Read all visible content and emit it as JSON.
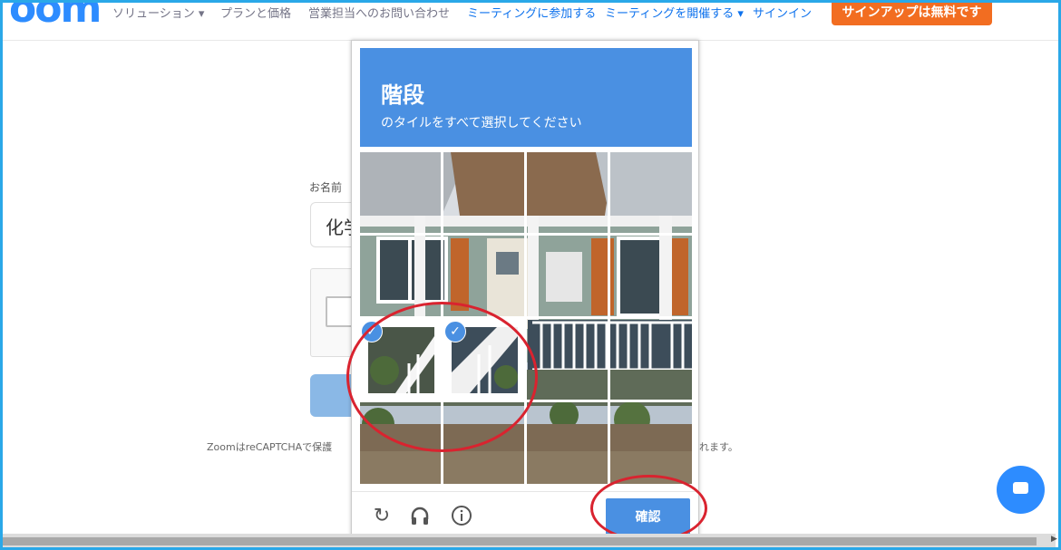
{
  "nav": {
    "logo": "oom",
    "items": [
      {
        "label": "ソリューション ▾"
      },
      {
        "label": "プランと価格"
      },
      {
        "label": "営業担当へのお問い合わせ"
      },
      {
        "label": "ミーティングに参加する"
      },
      {
        "label": "ミーティングを開催する ▾"
      },
      {
        "label": "サインイン"
      }
    ],
    "signup": "サインアップは無料です"
  },
  "form": {
    "name_label": "お名前",
    "name_value": "化学",
    "notice_start": "ZoomはreCAPTCHAで保護",
    "notice_end": "れます。"
  },
  "captcha": {
    "title": "階段",
    "subtitle": "のタイルをすべて選択してください",
    "selected_tiles": [
      8,
      9
    ],
    "verify": "確認",
    "icons": [
      "reload-icon",
      "audio-icon",
      "info-icon"
    ]
  },
  "colors": {
    "accent": "#4a90e2",
    "annotation": "#d9232f",
    "signup": "#f26d21"
  }
}
